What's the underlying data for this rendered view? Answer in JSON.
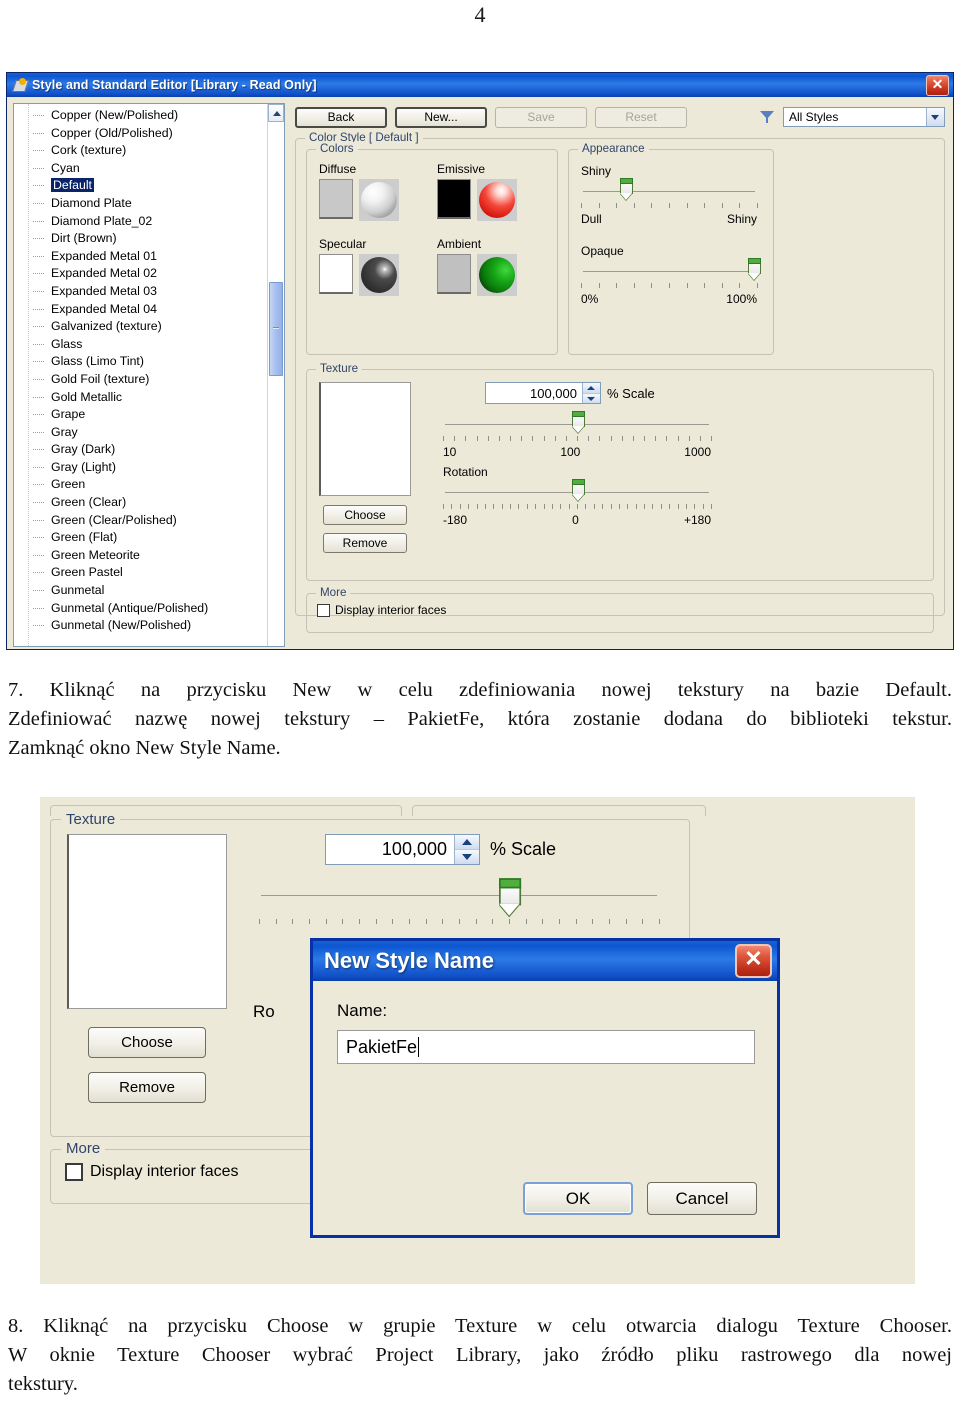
{
  "page": {
    "number": "4"
  },
  "paragraphs": {
    "step7": {
      "line1": "7. Kliknąć na przycisku New w celu zdefiniowania nowej tekstury na bazie Default.",
      "line2": "Zdefiniować nazwę nowej tekstury – PakietFe, która zostanie dodana do biblioteki tekstur.",
      "line3": "Zamknąć okno New Style Name."
    },
    "step8": {
      "line1": "8. Kliknąć na przycisku Choose w grupie Texture w celu otwarcia dialogu Texture Chooser.",
      "line2": "W oknie Texture Chooser wybrać Project Library, jako źródło pliku rastrowego dla nowej",
      "line3": "tekstury."
    }
  },
  "screenshot1": {
    "window": {
      "title": "Style and Standard Editor [Library - Read Only]",
      "close_label": "✕",
      "icon": "style-editor-icon"
    },
    "tree": {
      "selected": "Default",
      "items": [
        "Copper (New/Polished)",
        "Copper (Old/Polished)",
        "Cork (texture)",
        "Cyan",
        "Default",
        "Diamond Plate",
        "Diamond Plate_02",
        "Dirt (Brown)",
        "Expanded Metal 01",
        "Expanded Metal 02",
        "Expanded Metal 03",
        "Expanded Metal 04",
        "Galvanized (texture)",
        "Glass",
        "Glass (Limo Tint)",
        "Gold Foil (texture)",
        "Gold Metallic",
        "Grape",
        "Gray",
        "Gray (Dark)",
        "Gray (Light)",
        "Green",
        "Green (Clear)",
        "Green (Clear/Polished)",
        "Green (Flat)",
        "Green Meteorite",
        "Green Pastel",
        "Gunmetal",
        "Gunmetal (Antique/Polished)",
        "Gunmetal (New/Polished)"
      ]
    },
    "toolbar": {
      "back": "Back",
      "new": "New...",
      "save": "Save",
      "reset": "Reset",
      "filter_icon": "filter-icon",
      "filter_value": "All Styles"
    },
    "color_style_group": {
      "label": "Color Style [ Default ]"
    },
    "colors_group": {
      "label": "Colors",
      "swatches": [
        {
          "name": "Diffuse",
          "chip": "#c8c8c8",
          "ball": "#e8e8e8"
        },
        {
          "name": "Emissive",
          "chip": "#000000",
          "ball": "#e8271f"
        },
        {
          "name": "Specular",
          "chip": "#ffffff",
          "ball": "#383838"
        },
        {
          "name": "Ambient",
          "chip": "#c0c0c0",
          "ball": "#12a012"
        }
      ]
    },
    "appearance_group": {
      "label": "Appearance",
      "shiny": {
        "label": "Shiny",
        "min_label": "Dull",
        "max_label": "Shiny",
        "value_pct": 22
      },
      "opaque": {
        "label": "Opaque",
        "min_label": "0%",
        "max_label": "100%",
        "value_pct": 100
      }
    },
    "texture_group": {
      "label": "Texture",
      "scale_value": "100,000",
      "scale_unit": "% Scale",
      "scale_ticks": [
        "10",
        "100",
        "1000"
      ],
      "scale_pos_pct": 50,
      "rotation_label": "Rotation",
      "rotation_ticks": [
        "-180",
        "0",
        "+180"
      ],
      "rotation_pos_pct": 50,
      "choose_button": "Choose",
      "remove_button": "Remove"
    },
    "more_group": {
      "label": "More",
      "checkbox_label": "Display interior faces",
      "checked": false
    }
  },
  "screenshot2": {
    "texture_group": {
      "label": "Texture",
      "scale_value": "100,000",
      "scale_unit": "% Scale",
      "scale_pos_pct": 62,
      "rotation_partial_label": "Ro",
      "choose_button": "Choose",
      "remove_button": "Remove"
    },
    "more_group": {
      "label": "More",
      "checkbox_label": "Display interior faces",
      "checked": false
    },
    "dialog": {
      "title": "New Style Name",
      "close_label": "✕",
      "name_label": "Name:",
      "name_value": "PakietFe",
      "ok_button": "OK",
      "cancel_button": "Cancel"
    }
  },
  "colors": {
    "titlebar_blue": "#0c56d0",
    "dialog_border": "#0831a8",
    "window_face": "#ece9d8",
    "selection_blue": "#0a246a",
    "group_label": "#31456b",
    "slider_green": "#4fae3e"
  }
}
